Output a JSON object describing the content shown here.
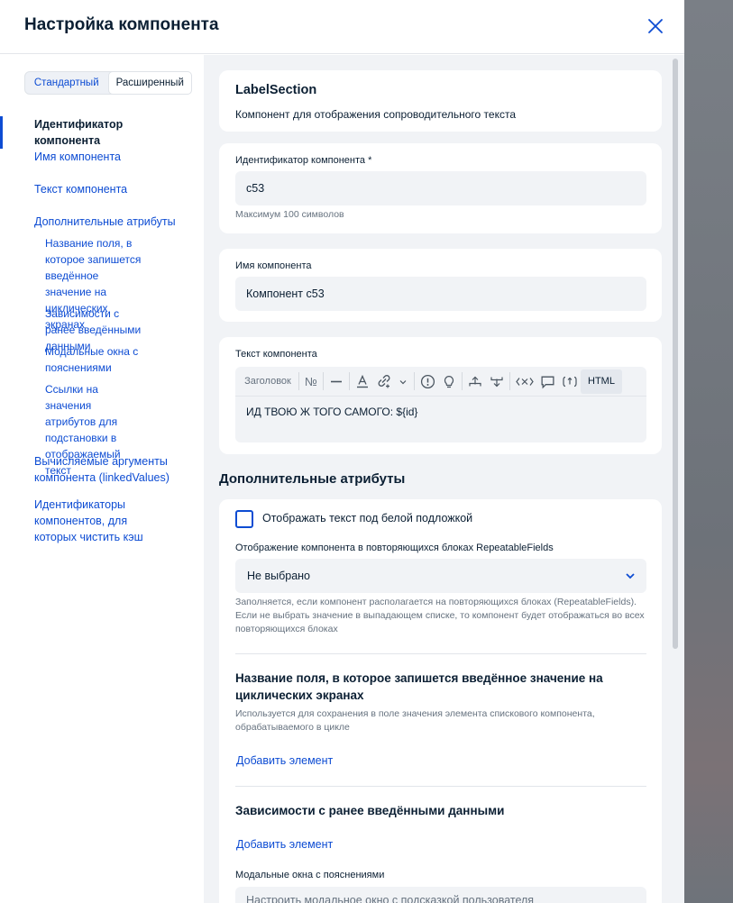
{
  "header": {
    "title": "Настройка компонента"
  },
  "mode_toggle": {
    "standard": "Стандартный",
    "advanced": "Расширенный"
  },
  "nav": {
    "items": [
      "Идентификатор компонента",
      "Имя компонента",
      "Текст компонента",
      "Дополнительные атрибуты"
    ],
    "sub_items": [
      "Название поля, в которое запишется введённое значение на циклических экранах",
      "Зависимости с ранее введёнными данными",
      "Модальные окна с пояснениями",
      "Ссылки на значения атрибутов для подстановки в отображаемый текст"
    ],
    "tail_items": [
      "Вычисляемые аргументы компонента (linkedValues)",
      "Идентификаторы компонентов, для которых чистить кэш"
    ]
  },
  "component": {
    "type": "LabelSection",
    "description": "Компонент для отображения сопроводительного текста"
  },
  "id_field": {
    "label": "Идентификатор компонента *",
    "value": "c53",
    "hint": "Максимум 100 символов"
  },
  "name_field": {
    "label": "Имя компонента",
    "value": "Компонент с53"
  },
  "text_field": {
    "label": "Текст компонента",
    "toolbar": {
      "heading": "Заголовок",
      "numero": "№",
      "html": "HTML"
    },
    "content": "ИД ТВОЮ Ж ТОГО САМОГО: ${id}"
  },
  "extra": {
    "title": "Дополнительные атрибуты",
    "checkbox_label": "Отображать текст под белой подложкой",
    "repeatable_label": "Отображение компонента в повторяющихся блоках RepeatableFields",
    "repeatable_value": "Не выбрано",
    "repeatable_hint": "Заполняется, если компонент располагается на повторяющихся блоках (RepeatableFields). Если не выбрать значение в выпадающем списке, то компонент будет отображаться во всех повторяющихся блоках",
    "cyclic_title": "Название поля, в которое запишется введённое значение на циклических экранах",
    "cyclic_hint": "Используется для сохранения в поле значения элемента спискового компонента, обрабатываемого в цикле",
    "add_label": "Добавить элемент",
    "deps_title": "Зависимости с ранее введёнными данными",
    "modals_label": "Модальные окна с пояснениями",
    "modals_value": "Настроить модальное окно с подсказкой пользователя"
  },
  "colors": {
    "accent": "#0d4cd3",
    "text": "#0b1f33",
    "muted": "#66727f",
    "surface": "#f1f3f6"
  }
}
